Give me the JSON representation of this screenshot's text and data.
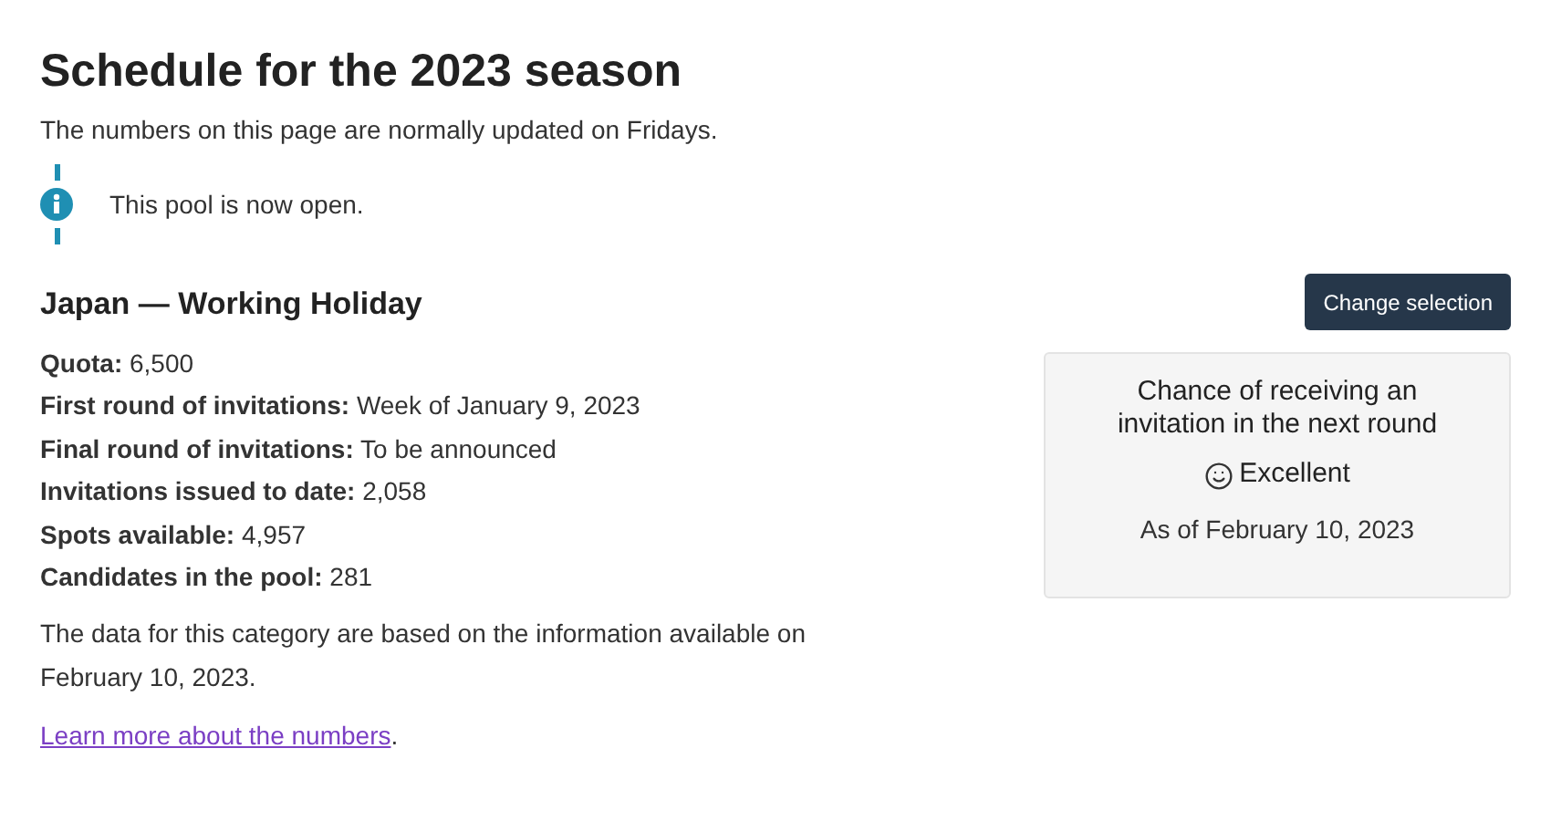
{
  "title": "Schedule for the 2023 season",
  "intro": "The numbers on this page are normally updated on Fridays.",
  "notice": {
    "text": "This pool is now open."
  },
  "pool": {
    "name": "Japan — Working Holiday",
    "facts": [
      {
        "label": "Quota:",
        "value": "6,500"
      },
      {
        "label": "First round of invitations:",
        "value": "Week of January 9, 2023"
      },
      {
        "label": "Final round of invitations:",
        "value": "To be announced"
      },
      {
        "label": "Invitations issued to date:",
        "value": "2,058"
      },
      {
        "label": "Spots available:",
        "value": "4,957"
      },
      {
        "label": "Candidates in the pool:",
        "value": "281"
      }
    ],
    "note": "The data for this category are based on the information available on February 10, 2023.",
    "learn_more": {
      "link": "Learn more about the numbers",
      "after": "."
    }
  },
  "change_button": "Change selection",
  "chance": {
    "heading": "Chance of receiving an invitation in the next round",
    "rating": "Excellent",
    "as_of": "As of February 10, 2023"
  }
}
